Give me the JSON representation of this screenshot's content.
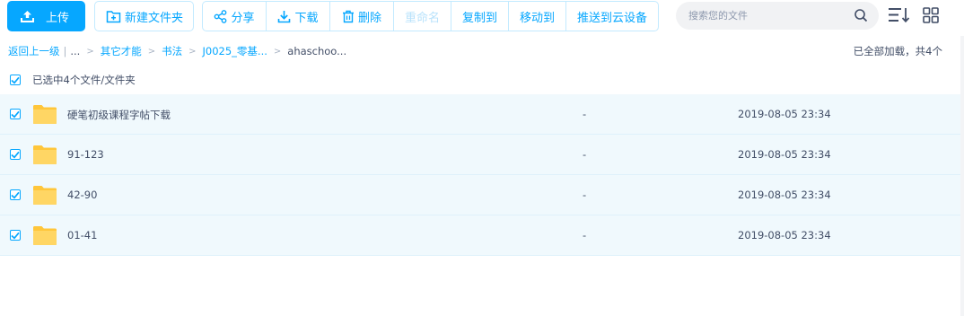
{
  "toolbar": {
    "upload_label": "上传",
    "new_folder_label": "新建文件夹",
    "actions": [
      {
        "label": "分享",
        "icon": "share-icon",
        "disabled": false
      },
      {
        "label": "下载",
        "icon": "download-icon",
        "disabled": false
      },
      {
        "label": "删除",
        "icon": "trash-icon",
        "disabled": false
      },
      {
        "label": "重命名",
        "icon": "",
        "disabled": true
      },
      {
        "label": "复制到",
        "icon": "",
        "disabled": false
      },
      {
        "label": "移动到",
        "icon": "",
        "disabled": false
      },
      {
        "label": "推送到云设备",
        "icon": "",
        "disabled": false
      }
    ]
  },
  "search": {
    "placeholder": "搜索您的文件",
    "value": ""
  },
  "breadcrumb": {
    "back": "返回上一级",
    "more": "...",
    "items": [
      "其它才能",
      "书法",
      "J0025_零基...",
      "ahaschoo..."
    ]
  },
  "load_status": "已全部加载，共4个",
  "selection": {
    "label": "已选中4个文件/文件夹",
    "checked": true
  },
  "files": [
    {
      "name": "硬笔初级课程字帖下载",
      "size": "-",
      "modified": "2019-08-05 23:34",
      "checked": true
    },
    {
      "name": "91-123",
      "size": "-",
      "modified": "2019-08-05 23:34",
      "checked": true
    },
    {
      "name": "42-90",
      "size": "-",
      "modified": "2019-08-05 23:34",
      "checked": true
    },
    {
      "name": "01-41",
      "size": "-",
      "modified": "2019-08-05 23:34",
      "checked": true
    }
  ],
  "colors": {
    "accent": "#06a7ff",
    "row_selected": "#f0f9fd",
    "folder": "#ffd05a",
    "text": "#424e67"
  }
}
